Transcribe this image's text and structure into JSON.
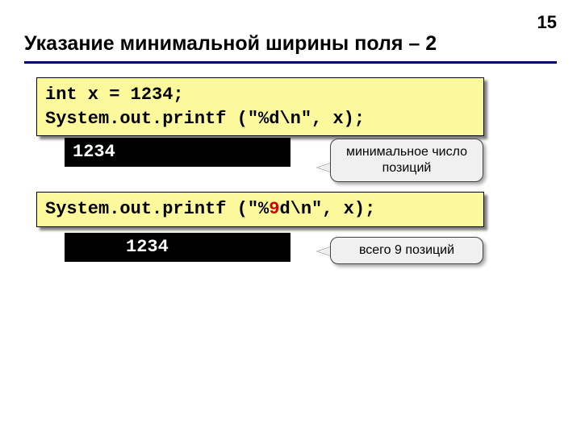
{
  "page_number": "15",
  "title": "Указание минимальной ширины поля – 2",
  "code1_line1": "int x = 1234;",
  "code1_line2": "System.out.printf (\"%d\\n\", x);",
  "output1": "1234",
  "callout1": "минимальное число позиций",
  "code2_pre": "System.out.printf (\"%",
  "code2_hl": "9",
  "code2_post": "d\\n\", x);",
  "output2": "     1234",
  "callout2": "всего 9 позиций"
}
